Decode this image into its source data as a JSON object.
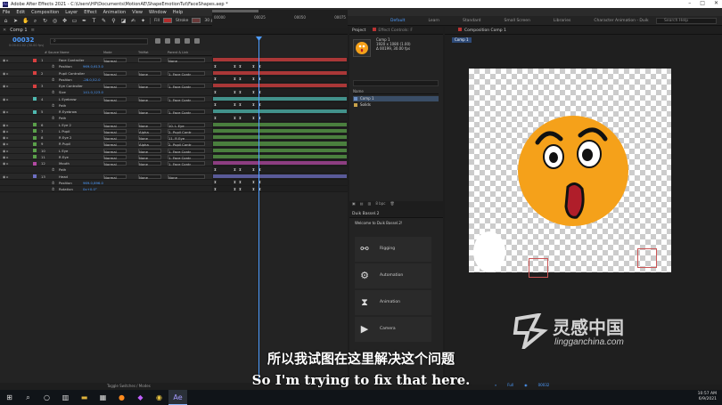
{
  "window": {
    "title": "Adobe After Effects 2021 - C:\\Users\\HP\\Documents\\MotionAE\\ShapeEmotionTut\\FaceShapes.aep *",
    "app_badge": "Ae"
  },
  "menu": [
    "File",
    "Edit",
    "Composition",
    "Layer",
    "Effect",
    "Animation",
    "View",
    "Window",
    "Help"
  ],
  "toolbar": {
    "fill_label": "Fill",
    "stroke_label": "Stroke",
    "stroke_width": "30 px",
    "add_label": "Add",
    "rotobezier_label": "RotoBezier",
    "fill_color": "#b42d2d",
    "stroke_color": "#6b3a3a"
  },
  "workspaces": [
    "Default",
    "Learn",
    "Standard",
    "Small Screen",
    "Libraries",
    "Character Animation - Duik"
  ],
  "help_search": {
    "placeholder": "Search Help"
  },
  "timeline": {
    "tab": "Comp 1",
    "timecode": "00032",
    "timecode_sub": "0:00:01:02 (30.00 fps)",
    "ruler_labels": [
      "00000",
      "00025",
      "00050",
      "00075"
    ],
    "headers": {
      "source": "# Source Name",
      "mode": "Mode",
      "trkmat": "TrkMat",
      "parent": "Parent & Link"
    },
    "footer": "Toggle Switches / Modes"
  },
  "layers": [
    {
      "num": "1",
      "name": "Face Controller",
      "color": "#d94040",
      "mode": "Normal",
      "trkmat": "",
      "parent": "None",
      "sub": false
    },
    {
      "num": "",
      "name": "Position",
      "value": "969.0,613.0",
      "sub": true
    },
    {
      "num": "2",
      "name": "Pupil Controller",
      "color": "#d94040",
      "mode": "Normal",
      "trkmat": "None",
      "parent": "1. Face Contr",
      "sub": false
    },
    {
      "num": "",
      "name": "Position",
      "value": "-28.0,52.0",
      "sub": true
    },
    {
      "num": "3",
      "name": "Eye Controller",
      "color": "#d94040",
      "mode": "Normal",
      "trkmat": "None",
      "parent": "1. Face Contr",
      "sub": false
    },
    {
      "num": "",
      "name": "Size",
      "value": "141.0,123.0",
      "sub": true
    },
    {
      "num": "4",
      "name": "L Eyebrow",
      "color": "#4fb9b0",
      "mode": "Normal",
      "trkmat": "None",
      "parent": "1. Face Contr",
      "sub": false
    },
    {
      "num": "",
      "name": "Path",
      "value": "",
      "sub": true
    },
    {
      "num": "5",
      "name": "R Eyebrow",
      "color": "#4fb9b0",
      "mode": "Normal",
      "trkmat": "None",
      "parent": "1. Face Contr",
      "sub": false
    },
    {
      "num": "",
      "name": "Path",
      "value": "",
      "sub": true
    },
    {
      "num": "6",
      "name": "L Eye 2",
      "color": "#5aa04a",
      "mode": "Normal",
      "trkmat": "None",
      "parent": "10. L Eye",
      "sub": false
    },
    {
      "num": "7",
      "name": "L Pupil",
      "color": "#5aa04a",
      "mode": "Normal",
      "trkmat": "Alpha",
      "parent": "2. Pupil Contr",
      "sub": false
    },
    {
      "num": "8",
      "name": "R Eye 2",
      "color": "#5aa04a",
      "mode": "Normal",
      "trkmat": "None",
      "parent": "11. R Eye",
      "sub": false
    },
    {
      "num": "9",
      "name": "R Pupil",
      "color": "#5aa04a",
      "mode": "Normal",
      "trkmat": "Alpha",
      "parent": "2. Pupil Contr",
      "sub": false
    },
    {
      "num": "10",
      "name": "L Eye",
      "color": "#5aa04a",
      "mode": "Normal",
      "trkmat": "None",
      "parent": "1. Face Contr",
      "sub": false
    },
    {
      "num": "11",
      "name": "R Eye",
      "color": "#5aa04a",
      "mode": "Normal",
      "trkmat": "None",
      "parent": "1. Face Contr",
      "sub": false
    },
    {
      "num": "12",
      "name": "Mouth",
      "color": "#b34aa3",
      "mode": "Normal",
      "trkmat": "None",
      "parent": "1. Face Contr",
      "sub": false
    },
    {
      "num": "",
      "name": "Path",
      "value": "",
      "sub": true
    },
    {
      "num": "13",
      "name": "Head",
      "color": "#6d6fc2",
      "mode": "Normal",
      "trkmat": "None",
      "parent": "None",
      "sub": false
    },
    {
      "num": "",
      "name": "Position",
      "value": "969.0,896.0",
      "sub": true
    },
    {
      "num": "",
      "name": "Rotation",
      "value": "0x+0.0°",
      "sub": true
    }
  ],
  "project": {
    "tabs": [
      "Project",
      "Effect Controls: F"
    ],
    "comp_name": "Comp 1",
    "comp_info": [
      "1920 x 1080 (1.00)",
      "Δ 00199, 30.00 fps"
    ],
    "list_header": "Name",
    "items": [
      {
        "name": "Comp 1",
        "type": "comp"
      },
      {
        "name": "Solids",
        "type": "folder"
      }
    ],
    "footer_bpc": "8 bpc"
  },
  "duik": {
    "tab": "Duik Bassel.2",
    "welcome": "Welcome to Duik Bassel.2!",
    "items": [
      "Rigging",
      "Automation",
      "Animation",
      "Camera"
    ]
  },
  "composition": {
    "tab": "Composition Comp 1",
    "subtab": "Comp 1",
    "zoom": "Full",
    "footer_timecode": "00032",
    "face_color": "#f5a11a",
    "mouth_color": "#b01e2a"
  },
  "subtitles": {
    "cn": "所以我试图在这里解决这个问题",
    "en": "So I'm trying to fix that here."
  },
  "watermark": {
    "cn": "灵感中国",
    "en": "lingganchina.com"
  },
  "taskbar": {
    "time": "10:57 AM",
    "date": "6/9/2021"
  }
}
